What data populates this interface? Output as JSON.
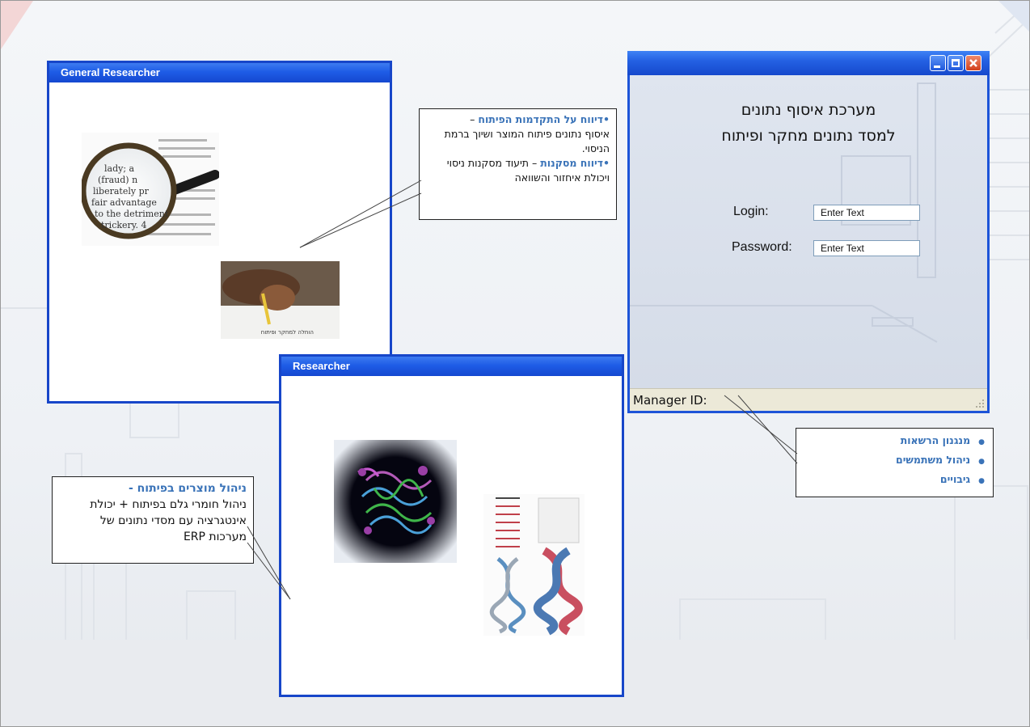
{
  "general_window": {
    "title": "General Researcher"
  },
  "researcher_window": {
    "title": "Researcher"
  },
  "callout_top": {
    "item1_heading": "•דיווח על התקדמות הפיתוח",
    "item1_dash": " –",
    "item1_body": "איסוף נתונים פיתוח המוצר ושיוך ברמת הניסוי.",
    "item2_heading": "•דיווח מסקנות",
    "item2_body": " – תיעוד מסקנות ניסוי ויכולת איחזור והשוואה"
  },
  "callout_left": {
    "heading": "ניהול מוצרים בפיתוח -",
    "body": "ניהול חומרי גלם בפיתוח + יכולת אינטגרציה עם מסדי נתונים של מערכות ERP"
  },
  "login_window": {
    "title_line1": "מערכת איסוף נתונים",
    "title_line2": "למסד נתונים מחקר ופיתוח",
    "login_label": "Login:",
    "login_value": "Enter Text",
    "password_label": "Password:",
    "password_value": "Enter Text",
    "status": "Manager ID:"
  },
  "callout_right": {
    "items": [
      "מנגנון הרשאות",
      "ניהול משתמשים",
      "גיבויים"
    ]
  },
  "image_caption": "הוחלה למחקר ופיתוח",
  "colors": {
    "window_border": "#1746c9",
    "callout_blue": "#3a73b8"
  }
}
